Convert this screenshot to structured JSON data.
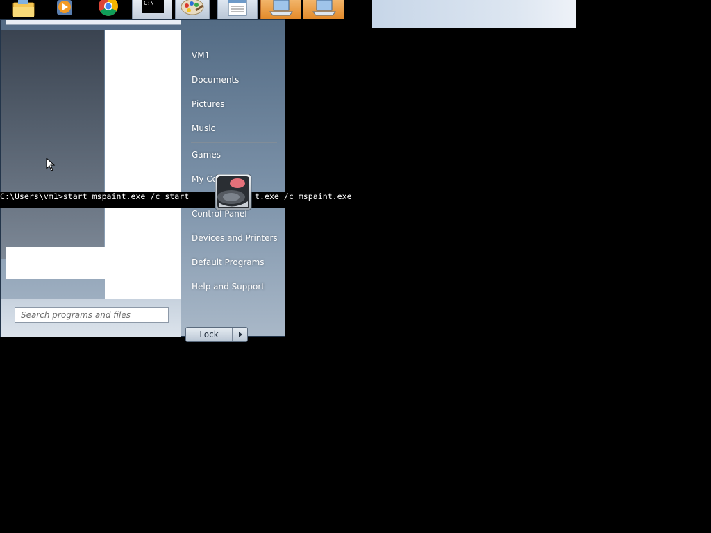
{
  "taskbar": {
    "buttons": [
      {
        "name": "explorer-icon"
      },
      {
        "name": "media-player-icon"
      },
      {
        "name": "chrome-icon"
      },
      {
        "name": "cmd-icon"
      },
      {
        "name": "paint-icon"
      },
      {
        "name": "notepad-icon"
      },
      {
        "name": "laptop-icon"
      },
      {
        "name": "laptop-icon"
      }
    ],
    "cmd_glyph": "C:\\_"
  },
  "start_menu": {
    "right_items": [
      "VM1",
      "Documents",
      "Pictures",
      "Music",
      "Games",
      "My Co",
      "Control Panel",
      "Devices and Printers",
      "Default Programs",
      "Help and Support"
    ],
    "lock_label": "Lock",
    "search_placeholder": "Search programs and files"
  },
  "command_line": "C:\\Users\\vm1>start mspaint.exe /c start",
  "command_line_tail": "t.exe /c mspaint.exe",
  "colors": {
    "accent_orange": "#e38a2a",
    "menu_blue": "#536b84"
  }
}
